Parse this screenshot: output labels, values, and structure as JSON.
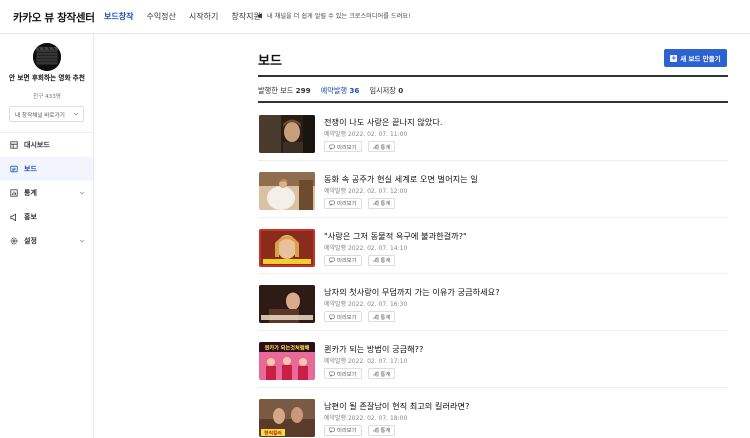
{
  "header": {
    "logo": "카카오 뷰 창작센터",
    "nav": [
      {
        "label": "보드창작",
        "active": true
      },
      {
        "label": "수익정산",
        "active": false
      },
      {
        "label": "시작하기",
        "active": false
      },
      {
        "label": "창작지원",
        "active": false
      }
    ],
    "notice": "내 채널을 더 쉽게 알릴 수 있는 크로스미디어를 드려요!"
  },
  "sidebar": {
    "channel_name": "안 보면 후회하는 영화 추천",
    "friends": "친구 433명",
    "channel_select": "내 창작채널 바로가기",
    "menu": [
      {
        "label": "대시보드",
        "icon": "dashboard-icon",
        "active": false,
        "expandable": false
      },
      {
        "label": "보드",
        "icon": "board-icon",
        "active": true,
        "expandable": false
      },
      {
        "label": "통계",
        "icon": "stats-icon",
        "active": false,
        "expandable": true
      },
      {
        "label": "홍보",
        "icon": "promo-icon",
        "active": false,
        "expandable": false
      },
      {
        "label": "설정",
        "icon": "settings-icon",
        "active": false,
        "expandable": true
      }
    ]
  },
  "main": {
    "title": "보드",
    "new_button": "새 보드 만들기",
    "tabs": [
      {
        "label": "발행한 보드",
        "count": "299",
        "active": false
      },
      {
        "label": "예약발행",
        "count": "36",
        "active": true
      },
      {
        "label": "임시저장",
        "count": "0",
        "active": false
      }
    ],
    "preview_label": "미리보기",
    "stats_label": "통계",
    "posts": [
      {
        "title": "전쟁이 나도 사랑은 끝나지 않았다.",
        "date": "예약발행 2022. 02. 07. 11:00"
      },
      {
        "title": "동화 속 공주가 현실 세계로 오면 벌어지는 일",
        "date": "예약발행 2022. 02. 07. 12:00"
      },
      {
        "title": "\"사랑은 그저 동물적 욕구에 불과한걸까?\"",
        "date": "예약발행 2022. 02. 07. 14:10"
      },
      {
        "title": "남자의 첫사랑이 무덤까지 가는 이유가 궁금하세요?",
        "date": "예약발행 2022. 02. 07. 16:30"
      },
      {
        "title": "퀸카가 되는 방법이 궁금해??",
        "date": "예약발행 2022. 02. 07. 17:10",
        "thumb_caption": "퀸카가 되는것처럼해"
      },
      {
        "title": "남편이 될 존잘남이 현직 최고의 킬러라면?",
        "date": "예약발행 2022. 02. 07. 18:00",
        "thumb_caption": "현직킬러"
      }
    ]
  },
  "colors": {
    "accent": "#1f4fb5",
    "button": "#2d62d3"
  }
}
